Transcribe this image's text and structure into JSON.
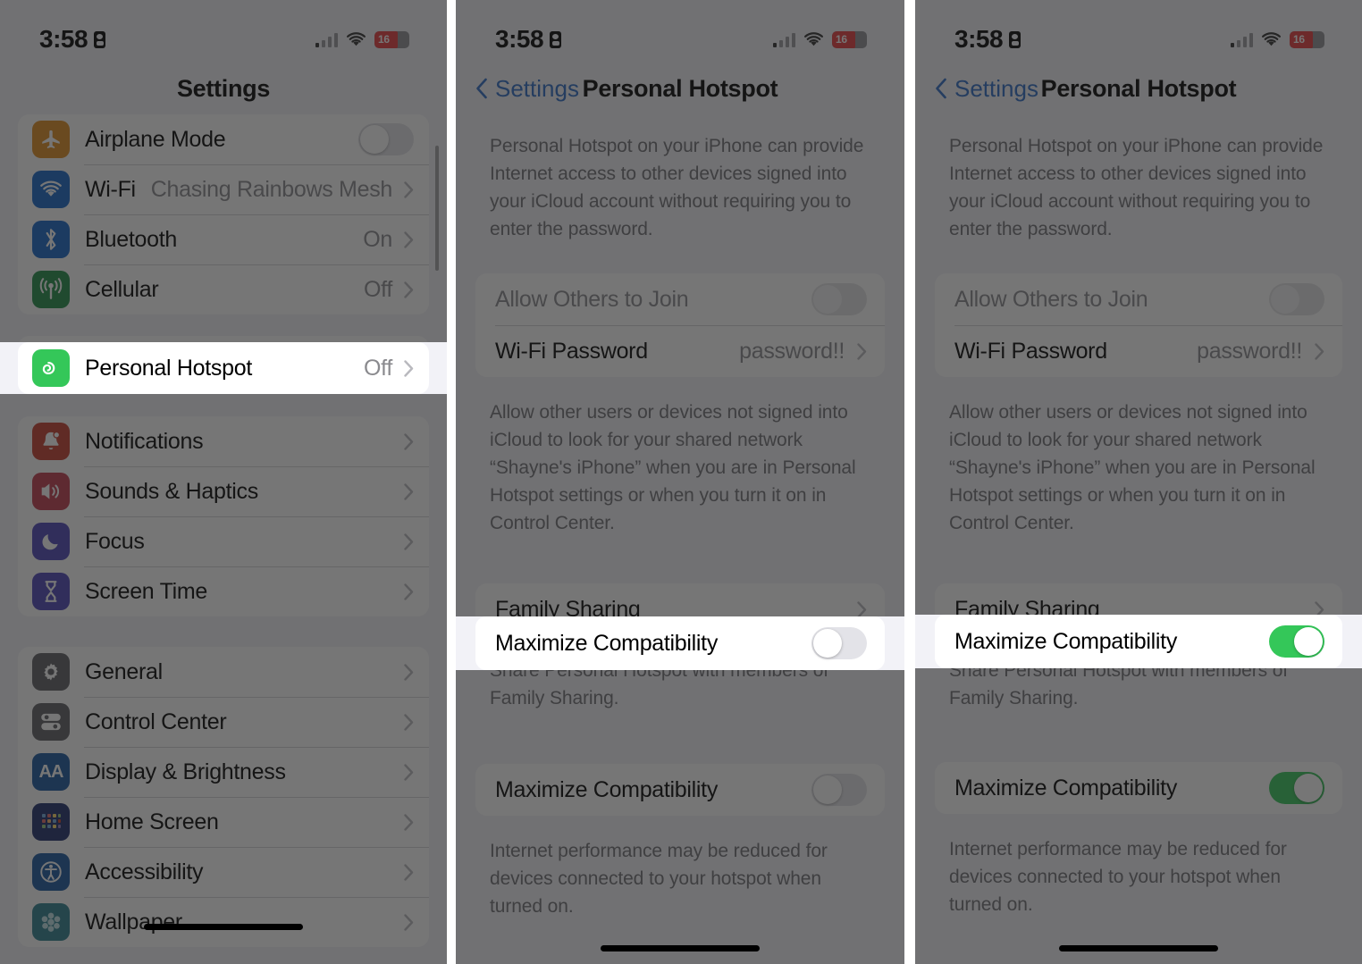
{
  "status_bar": {
    "time": "3:58",
    "lock_icon": "lock-portrait-icon",
    "battery_level": "16",
    "signal_icon": "cellular-signal-icon",
    "wifi_icon": "wifi-icon"
  },
  "panel1": {
    "nav_title": "Settings",
    "groups": [
      {
        "rows": [
          {
            "label": "Airplane Mode",
            "icon": "airplane-icon",
            "icon_color": "#e08b1d",
            "control": "toggle",
            "toggle_on": false
          },
          {
            "label": "Wi-Fi",
            "icon": "wifi-icon",
            "icon_color": "#1464c8",
            "value": "Chasing Rainbows Mesh",
            "control": "chevron"
          },
          {
            "label": "Bluetooth",
            "icon": "bluetooth-icon",
            "icon_color": "#1464c8",
            "value": "On",
            "control": "chevron"
          },
          {
            "label": "Cellular",
            "icon": "cellular-icon",
            "icon_color": "#1e8b44",
            "value": "Off",
            "control": "chevron"
          }
        ]
      },
      {
        "rows": [
          {
            "label": "Personal Hotspot",
            "icon": "hotspot-link-icon",
            "icon_color": "#34c759",
            "value": "Off",
            "control": "chevron",
            "highlighted": true
          }
        ]
      },
      {
        "rows": [
          {
            "label": "Notifications",
            "icon": "bell-icon",
            "icon_color": "#c43a2b",
            "control": "chevron"
          },
          {
            "label": "Sounds & Haptics",
            "icon": "speaker-icon",
            "icon_color": "#c0374a",
            "control": "chevron"
          },
          {
            "label": "Focus",
            "icon": "moon-icon",
            "icon_color": "#4b43b8",
            "control": "chevron"
          },
          {
            "label": "Screen Time",
            "icon": "hourglass-icon",
            "icon_color": "#4b43b8",
            "control": "chevron"
          }
        ]
      },
      {
        "rows": [
          {
            "label": "General",
            "icon": "gear-icon",
            "icon_color": "#5d5d62",
            "control": "chevron"
          },
          {
            "label": "Control Center",
            "icon": "sliders-icon",
            "icon_color": "#5d5d62",
            "control": "chevron"
          },
          {
            "label": "Display & Brightness",
            "icon": "text-size-icon",
            "icon_color": "#16569e",
            "control": "chevron"
          },
          {
            "label": "Home Screen",
            "icon": "app-grid-icon",
            "icon_color": "#1b2a6b",
            "control": "chevron"
          },
          {
            "label": "Accessibility",
            "icon": "accessibility-icon",
            "icon_color": "#16569e",
            "control": "chevron"
          },
          {
            "label": "Wallpaper",
            "icon": "flower-icon",
            "icon_color": "#2b7f8f",
            "control": "chevron"
          }
        ]
      }
    ]
  },
  "hotspot_page": {
    "nav_back_label": "Settings",
    "nav_title": "Personal Hotspot",
    "intro_text": "Personal Hotspot on your iPhone can provide Internet access to other devices signed into your iCloud account without requiring you to enter the password.",
    "rows": [
      {
        "label": "Allow Others to Join",
        "control": "toggle",
        "toggle_on": false,
        "disabled": true
      },
      {
        "label": "Wi-Fi Password",
        "value": "password!!",
        "control": "chevron"
      }
    ],
    "middle_footnote": "Allow other users or devices not signed into iCloud to look for your shared network “Shayne's iPhone” when you are in Personal Hotspot settings or when you turn it on in Control Center.",
    "family_sharing_label": "Family Sharing",
    "family_sharing_footnote": "Share Personal Hotspot with members of Family Sharing.",
    "maximize_compatibility_label": "Maximize Compatibility",
    "maximize_footnote": "Internet performance may be reduced for devices connected to your hotspot when turned on."
  },
  "panel2": {
    "maximize_toggle_on": false
  },
  "panel3": {
    "maximize_toggle_on": true
  },
  "colors": {
    "accent_blue": "#2a6bc4",
    "toggle_on_green": "#34c759",
    "battery_red": "#e8393b",
    "scrim": "rgba(34,34,34,0.62)"
  }
}
